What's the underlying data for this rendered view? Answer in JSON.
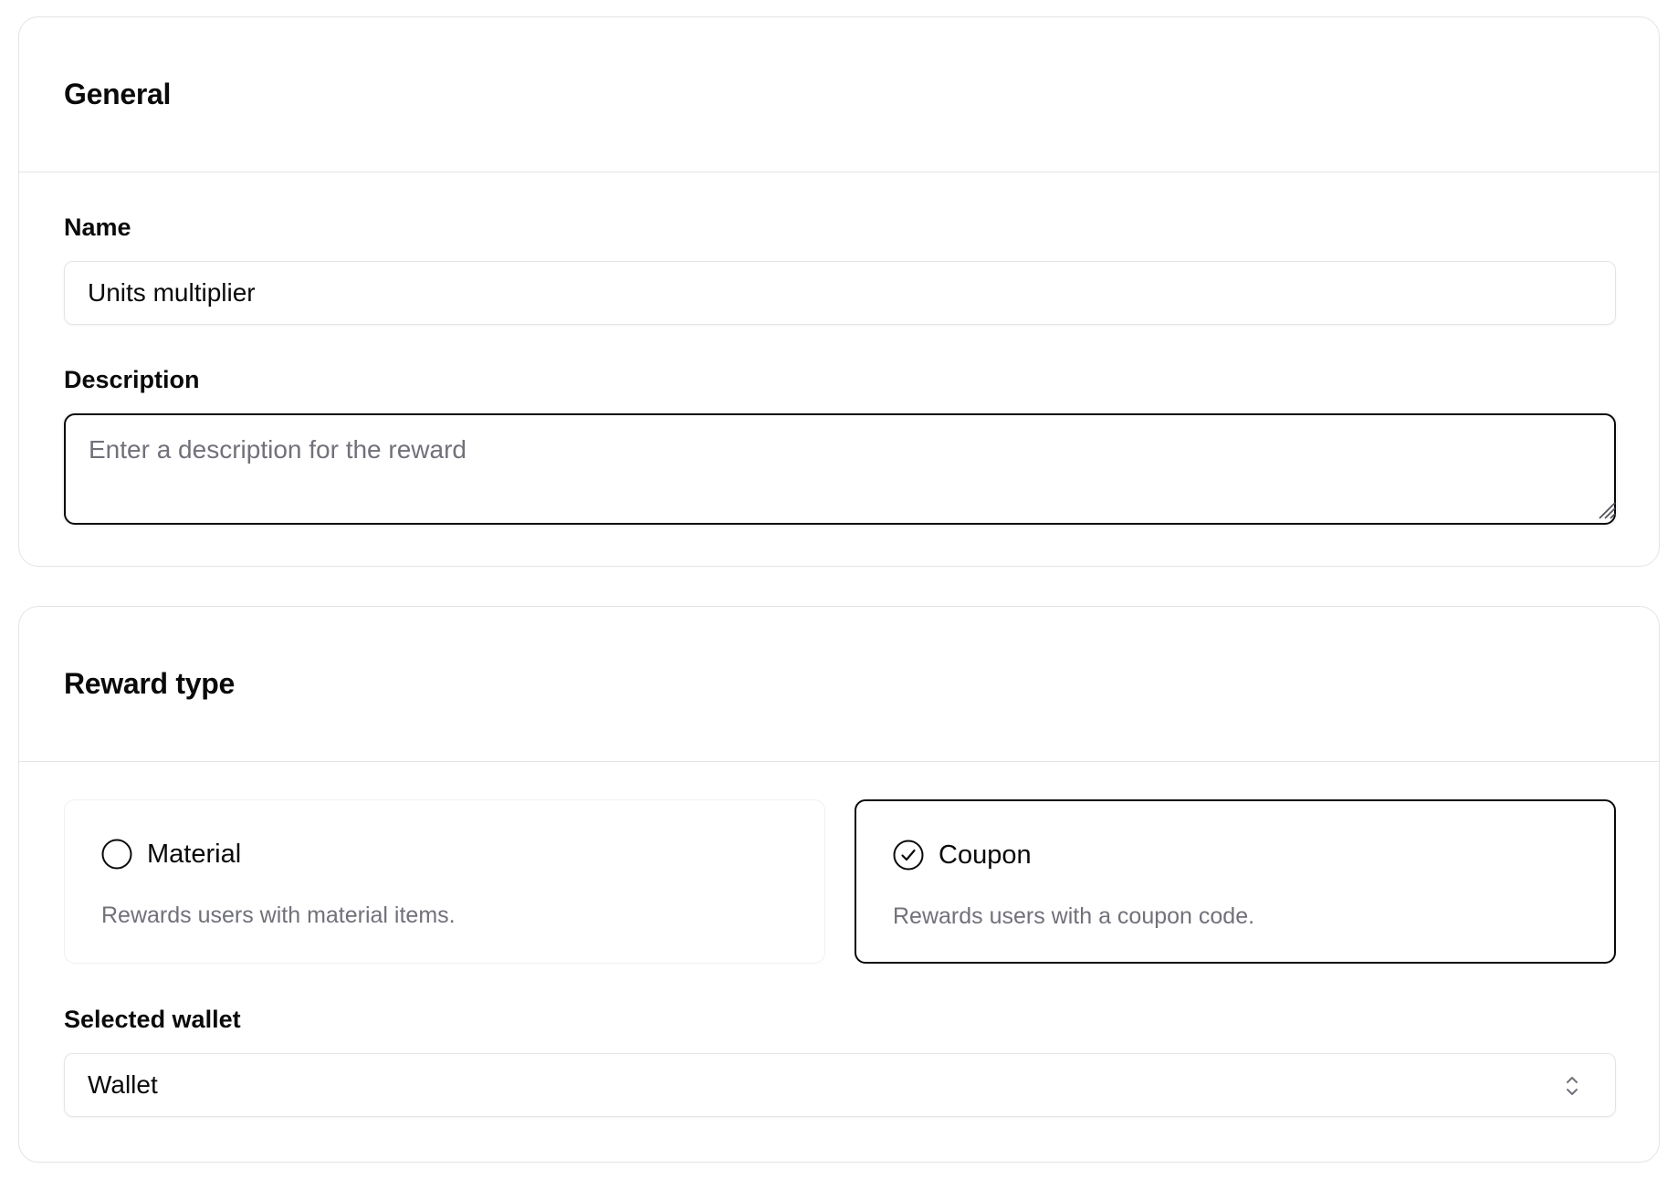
{
  "general": {
    "title": "General",
    "name_label": "Name",
    "name_value": "Units multiplier",
    "description_label": "Description",
    "description_placeholder": "Enter a description for the reward"
  },
  "reward_type": {
    "title": "Reward type",
    "options": [
      {
        "title": "Material",
        "description": "Rewards users with material items.",
        "selected": false
      },
      {
        "title": "Coupon",
        "description": "Rewards users with a coupon code.",
        "selected": true
      }
    ],
    "wallet_label": "Selected wallet",
    "wallet_value": "Wallet"
  },
  "colors": {
    "border": "#e4e4e7",
    "text": "#0a0a0a",
    "muted_text": "#71717a",
    "focus_border": "#0a0a0a"
  },
  "icons": [
    "radio-empty-icon",
    "radio-checked-icon",
    "resize-grip-icon",
    "chevron-up-down-icon"
  ]
}
